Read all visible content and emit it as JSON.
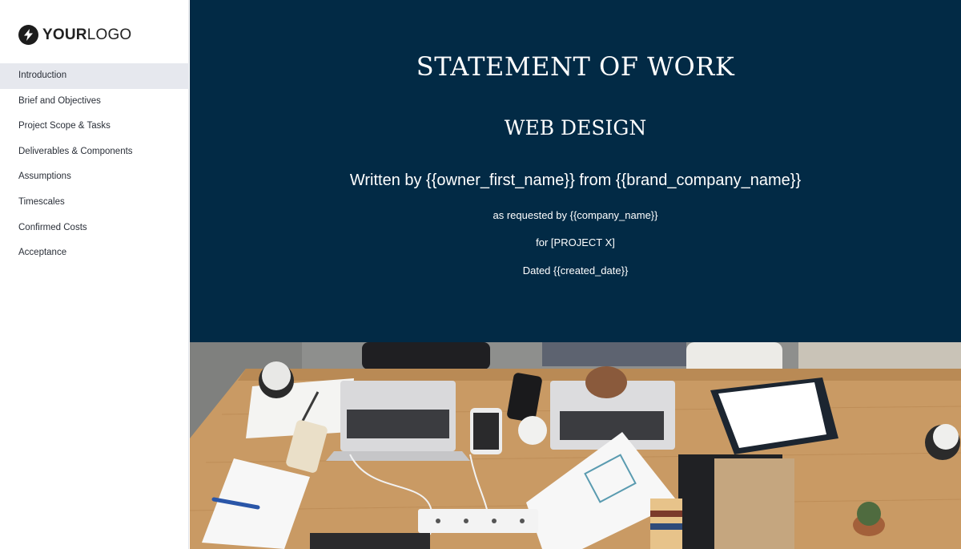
{
  "brand": {
    "logo_bold": "YOUR",
    "logo_light": "LOGO"
  },
  "sidebar": {
    "items": [
      {
        "label": "Introduction",
        "active": true
      },
      {
        "label": "Brief and Objectives"
      },
      {
        "label": "Project Scope & Tasks"
      },
      {
        "label": "Deliverables & Components"
      },
      {
        "label": "Assumptions"
      },
      {
        "label": "Timescales"
      },
      {
        "label": "Confirmed Costs"
      },
      {
        "label": "Acceptance"
      }
    ]
  },
  "hero": {
    "title": "STATEMENT OF WORK",
    "subtitle": "WEB DESIGN",
    "written_by": "Written by {{owner_first_name}} from {{brand_company_name}}",
    "requested_by": "as requested by {{company_name}}",
    "project": "for [PROJECT X]",
    "dated": "Dated {{created_date}}",
    "background_color": "#022a45"
  },
  "photo": {
    "icon": "office-desk-photo"
  }
}
